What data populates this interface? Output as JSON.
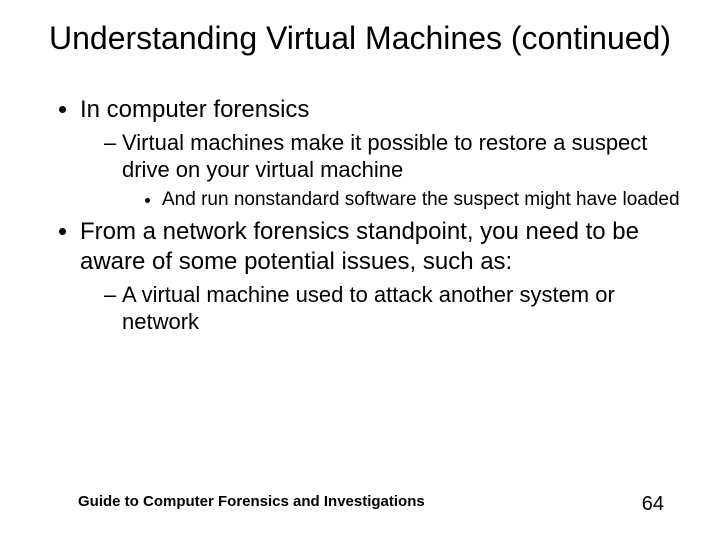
{
  "title": "Understanding Virtual Machines (continued)",
  "b1": "In computer forensics",
  "b1s1": "Virtual machines make it possible to restore a suspect drive on your virtual machine",
  "b1s1s1": "And run nonstandard software the suspect might have loaded",
  "b2": "From a network forensics standpoint, you need to be aware of some potential issues, such as:",
  "b2s1": "A virtual machine used to attack another system or network",
  "footer_text": "Guide to Computer Forensics and Investigations",
  "page_number": "64"
}
